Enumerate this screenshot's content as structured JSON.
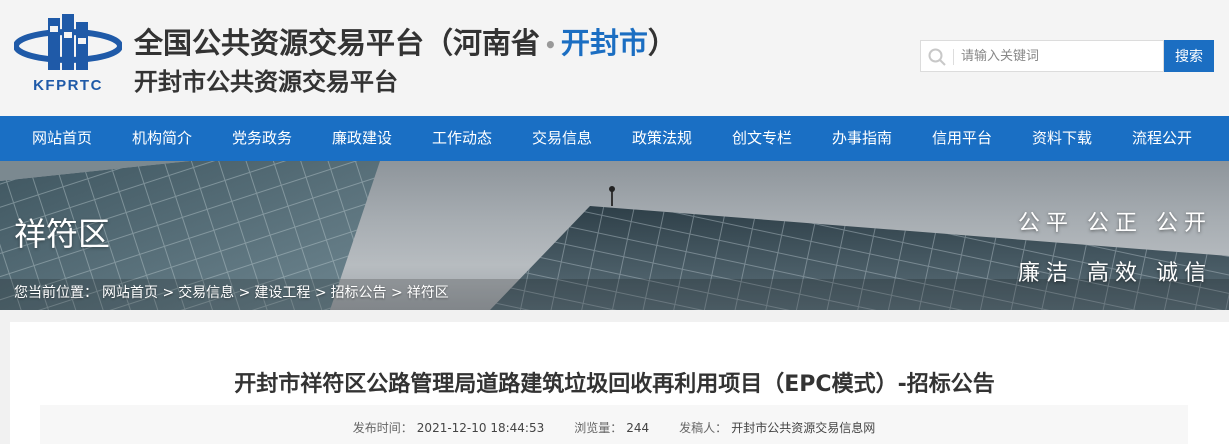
{
  "header": {
    "logo_text": "KFPRTC",
    "title_prefix": "全国公共资源交易平台（河南省",
    "title_dot": "•",
    "title_city": "开封市",
    "title_suffix": "）",
    "subtitle": "开封市公共资源交易平台"
  },
  "search": {
    "placeholder": "请输入关键词",
    "button_label": "搜索"
  },
  "nav": {
    "items": [
      "网站首页",
      "机构简介",
      "党务政务",
      "廉政建设",
      "工作动态",
      "交易信息",
      "政策法规",
      "创文专栏",
      "办事指南",
      "信用平台",
      "资料下载",
      "流程公开"
    ]
  },
  "banner": {
    "title": "祥符区",
    "slogan_line1": "公平 公正 公开",
    "slogan_line2": "廉洁 高效 诚信"
  },
  "breadcrumb": {
    "prefix": "您当前位置：",
    "items": [
      "网站首页",
      "交易信息",
      "建设工程",
      "招标公告",
      "祥符区"
    ],
    "separator": ">"
  },
  "article": {
    "title": "开封市祥符区公路管理局道路建筑垃圾回收再利用项目（EPC模式）-招标公告",
    "publish_label": "发布时间：",
    "publish_time": "2021-12-10 18:44:53",
    "views_label": "浏览量：",
    "views": "244",
    "publisher_label": "发稿人：",
    "publisher": "开封市公共资源交易信息网"
  },
  "colors": {
    "brand_blue": "#1a6fc4",
    "title_text": "#333333"
  }
}
